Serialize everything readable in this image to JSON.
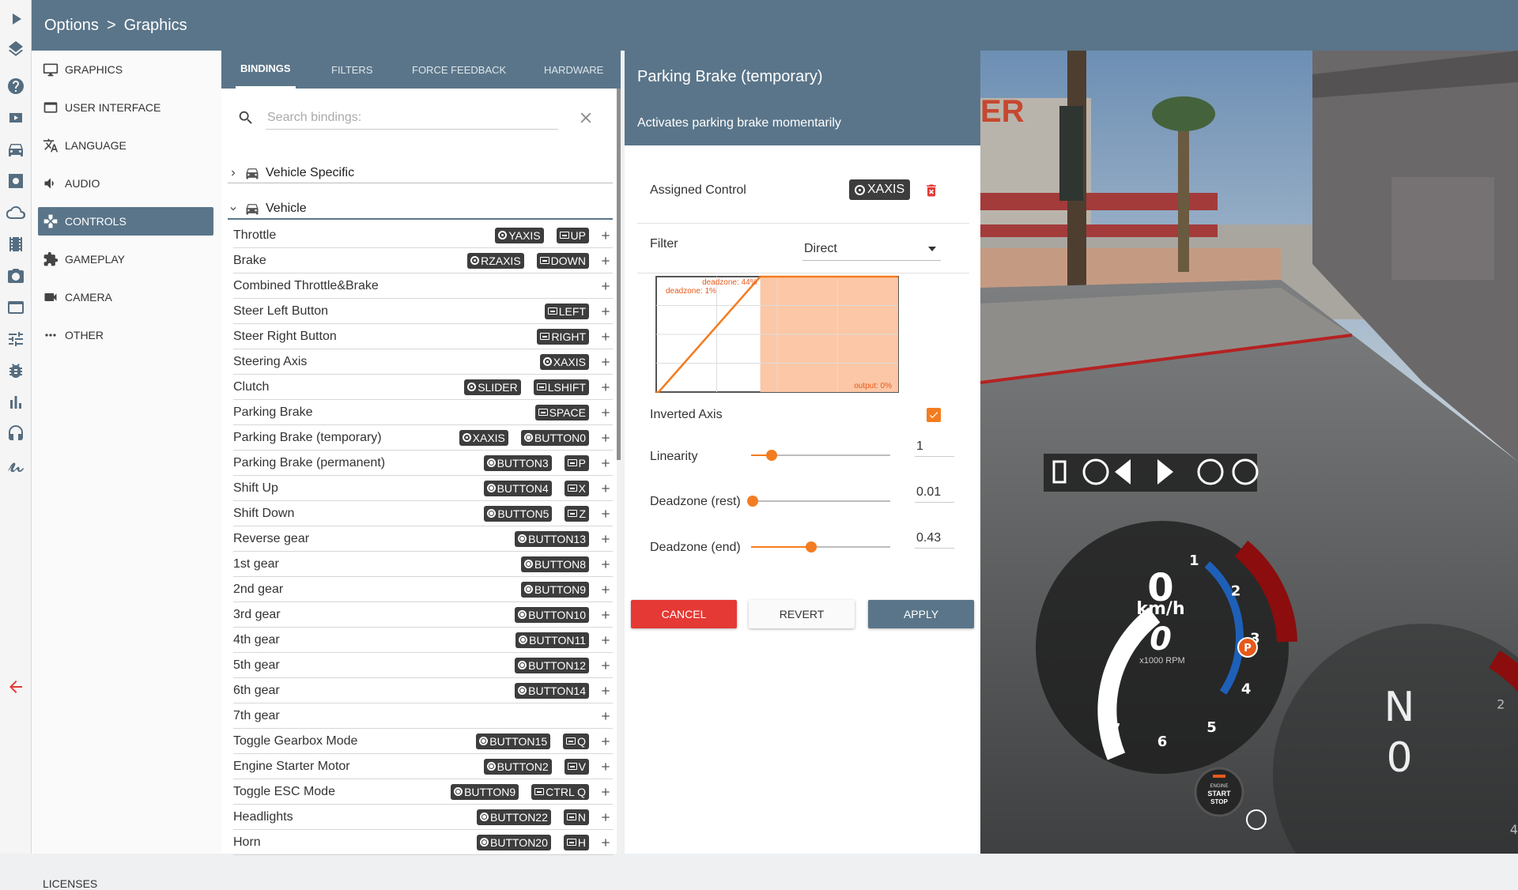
{
  "breadcrumb": {
    "root": "Options",
    "sep": ">",
    "current": "Graphics"
  },
  "rail_icons": [
    "play-icon",
    "layers-icon",
    "help-icon",
    "video-icon",
    "car-icon",
    "settings-icon",
    "cloud-icon",
    "film-icon",
    "camera-icon",
    "window-icon",
    "sliders-icon",
    "bug-icon",
    "bar-chart-icon",
    "headphones-icon",
    "signature-icon",
    "back-arrow-icon"
  ],
  "nav": {
    "items": [
      {
        "label": "GRAPHICS",
        "icon": "monitor-icon"
      },
      {
        "label": "USER INTERFACE",
        "icon": "window-icon"
      },
      {
        "label": "LANGUAGE",
        "icon": "translate-icon"
      },
      {
        "label": "AUDIO",
        "icon": "speaker-icon"
      },
      {
        "label": "CONTROLS",
        "icon": "gamepad-icon",
        "active": true
      },
      {
        "label": "GAMEPLAY",
        "icon": "puzzle-icon"
      },
      {
        "label": "CAMERA",
        "icon": "videocam-icon"
      },
      {
        "label": "OTHER",
        "icon": "more-icon"
      }
    ],
    "licenses": "LICENSES"
  },
  "tabs": [
    "BINDINGS",
    "FILTERS",
    "FORCE FEEDBACK",
    "HARDWARE"
  ],
  "search": {
    "placeholder": "Search bindings:"
  },
  "groups": {
    "vehicle_specific": "Vehicle Specific",
    "vehicle": "Vehicle"
  },
  "bindings": [
    {
      "name": "Throttle",
      "chips": [
        {
          "t": "axis",
          "l": "YAXIS"
        },
        {
          "t": "kbd",
          "l": "UP"
        }
      ]
    },
    {
      "name": "Brake",
      "chips": [
        {
          "t": "axis",
          "l": "RZAXIS"
        },
        {
          "t": "kbd",
          "l": "DOWN"
        }
      ]
    },
    {
      "name": "Combined Throttle&Brake",
      "chips": []
    },
    {
      "name": "Steer Left Button",
      "chips": [
        {
          "t": "kbd",
          "l": "LEFT"
        }
      ]
    },
    {
      "name": "Steer Right Button",
      "chips": [
        {
          "t": "kbd",
          "l": "RIGHT"
        }
      ]
    },
    {
      "name": "Steering Axis",
      "chips": [
        {
          "t": "axis",
          "l": "XAXIS"
        }
      ]
    },
    {
      "name": "Clutch",
      "chips": [
        {
          "t": "axis",
          "l": "SLIDER"
        },
        {
          "t": "kbd",
          "l": "LSHIFT"
        }
      ]
    },
    {
      "name": "Parking Brake",
      "chips": [
        {
          "t": "kbd",
          "l": "SPACE"
        }
      ]
    },
    {
      "name": "Parking Brake (temporary)",
      "chips": [
        {
          "t": "axis",
          "l": "XAXIS"
        },
        {
          "t": "btn",
          "l": "BUTTON0"
        }
      ]
    },
    {
      "name": "Parking Brake (permanent)",
      "chips": [
        {
          "t": "btn",
          "l": "BUTTON3"
        },
        {
          "t": "kbd",
          "l": "P"
        }
      ]
    },
    {
      "name": "Shift Up",
      "chips": [
        {
          "t": "btn",
          "l": "BUTTON4"
        },
        {
          "t": "kbd",
          "l": "X"
        }
      ]
    },
    {
      "name": "Shift Down",
      "chips": [
        {
          "t": "btn",
          "l": "BUTTON5"
        },
        {
          "t": "kbd",
          "l": "Z"
        }
      ]
    },
    {
      "name": "Reverse gear",
      "chips": [
        {
          "t": "btn",
          "l": "BUTTON13"
        }
      ]
    },
    {
      "name": "1st gear",
      "chips": [
        {
          "t": "btn",
          "l": "BUTTON8"
        }
      ]
    },
    {
      "name": "2nd gear",
      "chips": [
        {
          "t": "btn",
          "l": "BUTTON9"
        }
      ]
    },
    {
      "name": "3rd gear",
      "chips": [
        {
          "t": "btn",
          "l": "BUTTON10"
        }
      ]
    },
    {
      "name": "4th gear",
      "chips": [
        {
          "t": "btn",
          "l": "BUTTON11"
        }
      ]
    },
    {
      "name": "5th gear",
      "chips": [
        {
          "t": "btn",
          "l": "BUTTON12"
        }
      ]
    },
    {
      "name": "6th gear",
      "chips": [
        {
          "t": "btn",
          "l": "BUTTON14"
        }
      ]
    },
    {
      "name": "7th gear",
      "chips": []
    },
    {
      "name": "Toggle Gearbox Mode",
      "chips": [
        {
          "t": "btn",
          "l": "BUTTON15"
        },
        {
          "t": "kbd",
          "l": "Q"
        }
      ]
    },
    {
      "name": "Engine Starter Motor",
      "chips": [
        {
          "t": "btn",
          "l": "BUTTON2"
        },
        {
          "t": "kbd",
          "l": "V"
        }
      ]
    },
    {
      "name": "Toggle ESC Mode",
      "chips": [
        {
          "t": "btn",
          "l": "BUTTON9"
        },
        {
          "t": "kbd",
          "l": "CTRL Q"
        }
      ]
    },
    {
      "name": "Headlights",
      "chips": [
        {
          "t": "btn",
          "l": "BUTTON22"
        },
        {
          "t": "kbd",
          "l": "N"
        }
      ]
    },
    {
      "name": "Horn",
      "chips": [
        {
          "t": "btn",
          "l": "BUTTON20"
        },
        {
          "t": "kbd",
          "l": "H"
        }
      ]
    }
  ],
  "detail": {
    "title": "Parking Brake (temporary)",
    "description": "Activates parking brake momentarily",
    "assigned_label": "Assigned Control",
    "assigned_value": "XAXIS",
    "filter_label": "Filter",
    "filter_value": "Direct",
    "curve": {
      "deadzone_end_label": "deadzone: 44%",
      "deadzone_start_label": "deadzone: 1%",
      "output_label": "output: 0%",
      "deadzone_start": 0.01,
      "deadzone_end": 0.43
    },
    "inverted_label": "Inverted Axis",
    "inverted_checked": true,
    "linearity_label": "Linearity",
    "linearity_value": "1",
    "linearity_level": 0.15,
    "deadzone_rest_label": "Deadzone (rest)",
    "deadzone_rest_value": "0.01",
    "deadzone_rest_level": 0.01,
    "deadzone_end_label": "Deadzone (end)",
    "deadzone_end_value": "0.43",
    "deadzone_end_level": 0.43,
    "cancel": "CANCEL",
    "revert": "REVERT",
    "apply": "APPLY"
  },
  "hud": {
    "speed": "0",
    "speed_unit": "km/h",
    "gear": "0",
    "rpm_label": "x1000 RPM",
    "ticks": [
      "1",
      "2",
      "3",
      "4",
      "5",
      "6",
      "7"
    ],
    "gear_display": "N",
    "gear_speed": "0",
    "start_button": [
      "ENGINE",
      "START",
      "STOP"
    ],
    "sign_text": "ER",
    "colors": {
      "accent": "#f47c20",
      "header": "#5a7589",
      "danger": "#e53935",
      "redline": "#8b0d0d"
    }
  }
}
